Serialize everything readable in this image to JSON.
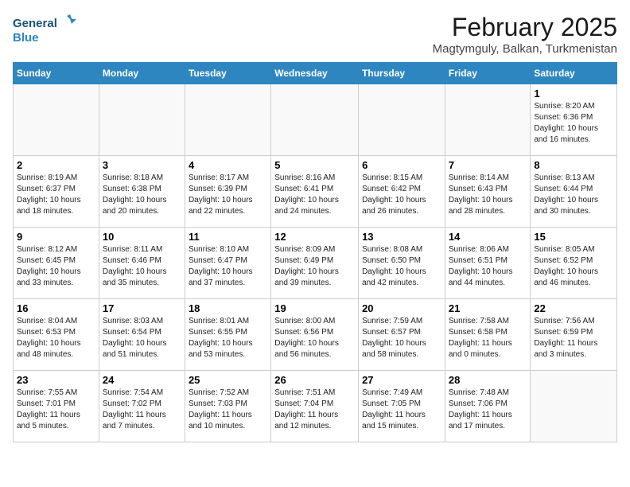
{
  "logo": {
    "line1": "General",
    "line2": "Blue"
  },
  "title": "February 2025",
  "subtitle": "Magtymguly, Balkan, Turkmenistan",
  "headers": [
    "Sunday",
    "Monday",
    "Tuesday",
    "Wednesday",
    "Thursday",
    "Friday",
    "Saturday"
  ],
  "weeks": [
    [
      {
        "day": "",
        "info": ""
      },
      {
        "day": "",
        "info": ""
      },
      {
        "day": "",
        "info": ""
      },
      {
        "day": "",
        "info": ""
      },
      {
        "day": "",
        "info": ""
      },
      {
        "day": "",
        "info": ""
      },
      {
        "day": "1",
        "info": "Sunrise: 8:20 AM\nSunset: 6:36 PM\nDaylight: 10 hours\nand 16 minutes."
      }
    ],
    [
      {
        "day": "2",
        "info": "Sunrise: 8:19 AM\nSunset: 6:37 PM\nDaylight: 10 hours\nand 18 minutes."
      },
      {
        "day": "3",
        "info": "Sunrise: 8:18 AM\nSunset: 6:38 PM\nDaylight: 10 hours\nand 20 minutes."
      },
      {
        "day": "4",
        "info": "Sunrise: 8:17 AM\nSunset: 6:39 PM\nDaylight: 10 hours\nand 22 minutes."
      },
      {
        "day": "5",
        "info": "Sunrise: 8:16 AM\nSunset: 6:41 PM\nDaylight: 10 hours\nand 24 minutes."
      },
      {
        "day": "6",
        "info": "Sunrise: 8:15 AM\nSunset: 6:42 PM\nDaylight: 10 hours\nand 26 minutes."
      },
      {
        "day": "7",
        "info": "Sunrise: 8:14 AM\nSunset: 6:43 PM\nDaylight: 10 hours\nand 28 minutes."
      },
      {
        "day": "8",
        "info": "Sunrise: 8:13 AM\nSunset: 6:44 PM\nDaylight: 10 hours\nand 30 minutes."
      }
    ],
    [
      {
        "day": "9",
        "info": "Sunrise: 8:12 AM\nSunset: 6:45 PM\nDaylight: 10 hours\nand 33 minutes."
      },
      {
        "day": "10",
        "info": "Sunrise: 8:11 AM\nSunset: 6:46 PM\nDaylight: 10 hours\nand 35 minutes."
      },
      {
        "day": "11",
        "info": "Sunrise: 8:10 AM\nSunset: 6:47 PM\nDaylight: 10 hours\nand 37 minutes."
      },
      {
        "day": "12",
        "info": "Sunrise: 8:09 AM\nSunset: 6:49 PM\nDaylight: 10 hours\nand 39 minutes."
      },
      {
        "day": "13",
        "info": "Sunrise: 8:08 AM\nSunset: 6:50 PM\nDaylight: 10 hours\nand 42 minutes."
      },
      {
        "day": "14",
        "info": "Sunrise: 8:06 AM\nSunset: 6:51 PM\nDaylight: 10 hours\nand 44 minutes."
      },
      {
        "day": "15",
        "info": "Sunrise: 8:05 AM\nSunset: 6:52 PM\nDaylight: 10 hours\nand 46 minutes."
      }
    ],
    [
      {
        "day": "16",
        "info": "Sunrise: 8:04 AM\nSunset: 6:53 PM\nDaylight: 10 hours\nand 48 minutes."
      },
      {
        "day": "17",
        "info": "Sunrise: 8:03 AM\nSunset: 6:54 PM\nDaylight: 10 hours\nand 51 minutes."
      },
      {
        "day": "18",
        "info": "Sunrise: 8:01 AM\nSunset: 6:55 PM\nDaylight: 10 hours\nand 53 minutes."
      },
      {
        "day": "19",
        "info": "Sunrise: 8:00 AM\nSunset: 6:56 PM\nDaylight: 10 hours\nand 56 minutes."
      },
      {
        "day": "20",
        "info": "Sunrise: 7:59 AM\nSunset: 6:57 PM\nDaylight: 10 hours\nand 58 minutes."
      },
      {
        "day": "21",
        "info": "Sunrise: 7:58 AM\nSunset: 6:58 PM\nDaylight: 11 hours\nand 0 minutes."
      },
      {
        "day": "22",
        "info": "Sunrise: 7:56 AM\nSunset: 6:59 PM\nDaylight: 11 hours\nand 3 minutes."
      }
    ],
    [
      {
        "day": "23",
        "info": "Sunrise: 7:55 AM\nSunset: 7:01 PM\nDaylight: 11 hours\nand 5 minutes."
      },
      {
        "day": "24",
        "info": "Sunrise: 7:54 AM\nSunset: 7:02 PM\nDaylight: 11 hours\nand 7 minutes."
      },
      {
        "day": "25",
        "info": "Sunrise: 7:52 AM\nSunset: 7:03 PM\nDaylight: 11 hours\nand 10 minutes."
      },
      {
        "day": "26",
        "info": "Sunrise: 7:51 AM\nSunset: 7:04 PM\nDaylight: 11 hours\nand 12 minutes."
      },
      {
        "day": "27",
        "info": "Sunrise: 7:49 AM\nSunset: 7:05 PM\nDaylight: 11 hours\nand 15 minutes."
      },
      {
        "day": "28",
        "info": "Sunrise: 7:48 AM\nSunset: 7:06 PM\nDaylight: 11 hours\nand 17 minutes."
      },
      {
        "day": "",
        "info": ""
      }
    ]
  ]
}
